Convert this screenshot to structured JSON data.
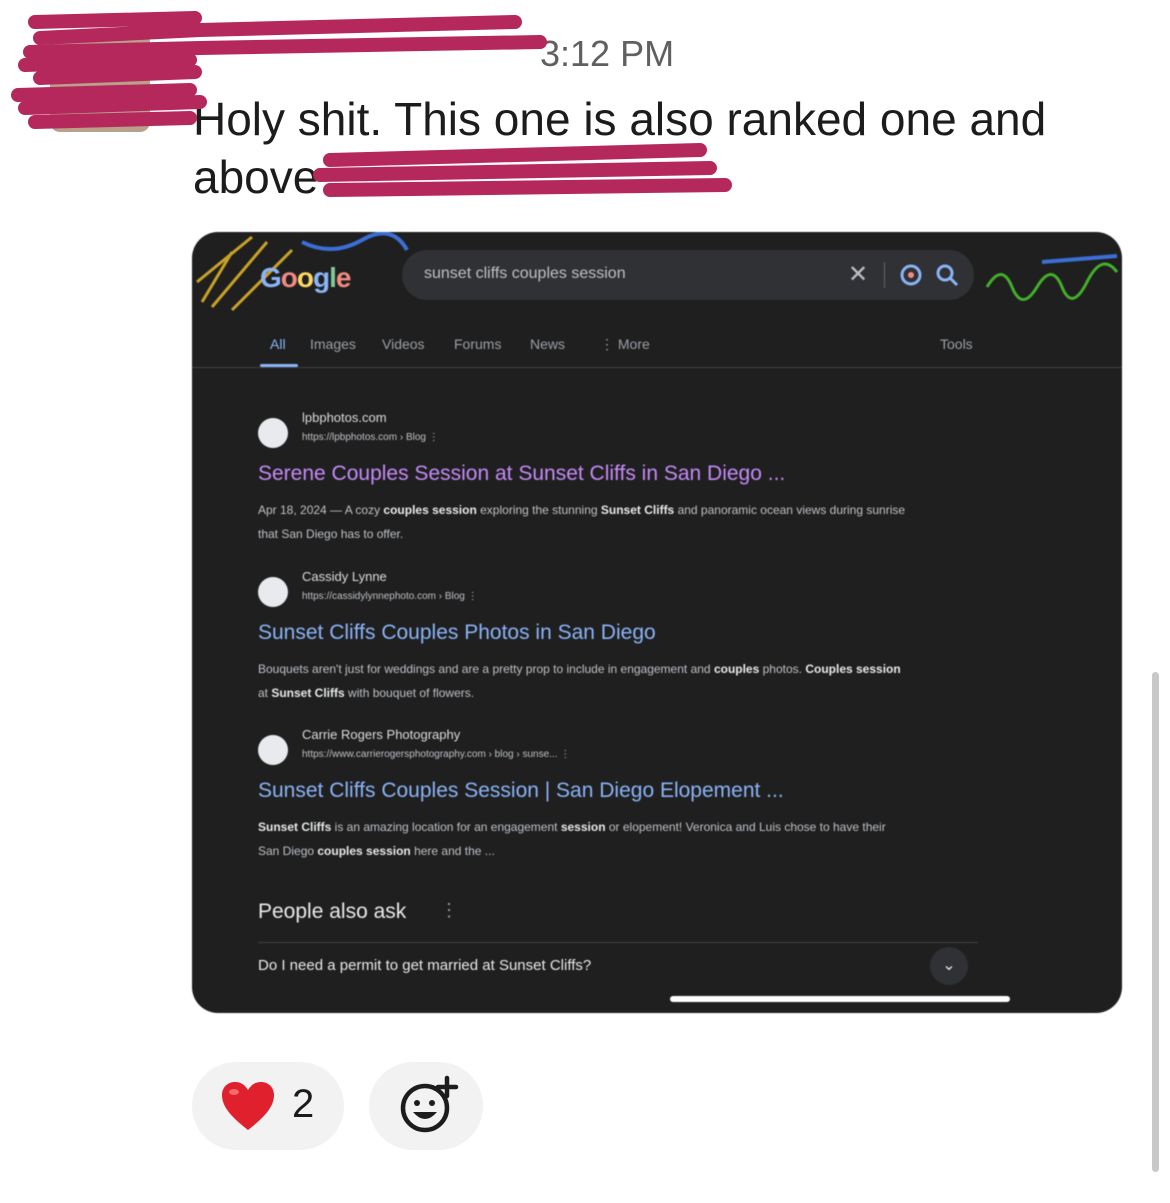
{
  "message": {
    "sender": "",
    "time": "3:12 PM",
    "text_line1": "Holy shit. This one is also ranked one and",
    "text_line2_prefix": "above"
  },
  "screenshot": {
    "logo": "Google",
    "search_query": "sunset cliffs couples session",
    "tabs": [
      "All",
      "Images",
      "Videos",
      "Forums",
      "News",
      "⋮ More"
    ],
    "tools_label": "Tools",
    "results": [
      {
        "site": "lpbphotos.com",
        "url": "https://lpbphotos.com › Blog  ⋮",
        "title": "Serene Couples Session at Sunset Cliffs in San Diego ...",
        "snippet_html_parts": [
          "Apr 18, 2024 — A cozy ",
          "couples session",
          " exploring the stunning ",
          "Sunset Cliffs",
          " and panoramic ocean views during sunrise that San Diego has to offer."
        ]
      },
      {
        "site": "Cassidy Lynne",
        "url": "https://cassidylynnephoto.com › Blog  ⋮",
        "title": "Sunset Cliffs Couples Photos in San Diego",
        "snippet_html_parts": [
          "Bouquets aren't just for weddings and are a pretty prop to include in engagement and ",
          "couples",
          " photos. ",
          "Couples session",
          " at ",
          "Sunset Cliffs",
          " with bouquet of flowers."
        ]
      },
      {
        "site": "Carrie Rogers Photography",
        "url": "https://www.carrierogersphotography.com › blog › sunse...  ⋮",
        "title": "Sunset Cliffs Couples Session | San Diego Elopement ...",
        "snippet_html_parts": [
          "",
          "Sunset Cliffs",
          " is an amazing location for an engagement ",
          "session",
          " or elopement! Veronica and Luis chose to have their San Diego ",
          "couples session",
          " here and the ..."
        ]
      }
    ],
    "people_also_ask": "People also ask",
    "paa_question": "Do I need a permit to get married at Sunset Cliffs?"
  },
  "reactions": {
    "heart_emoji": "❤️",
    "heart_count": "2",
    "add_reaction_icon": "add-reaction-icon"
  },
  "colors": {
    "redaction": "#b5285c",
    "screenshot_bg": "#1f1f1f",
    "link_visited": "#c58af9",
    "link": "#8ab4f8"
  }
}
